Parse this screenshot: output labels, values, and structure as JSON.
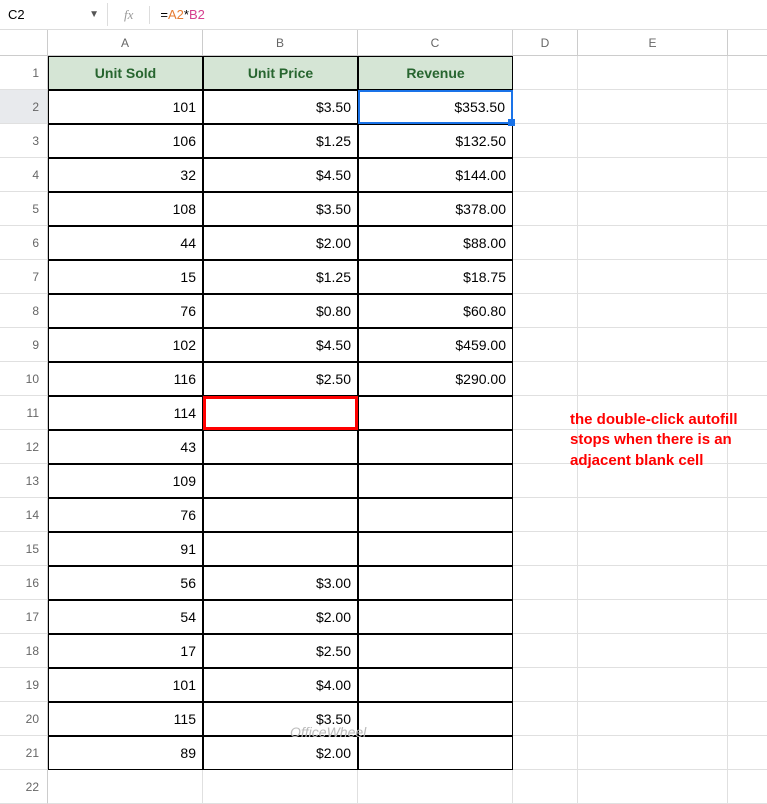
{
  "formula_bar": {
    "cell_ref": "C2",
    "fx_label": "fx",
    "formula_equals": "=",
    "formula_ref1": "A2",
    "formula_op": "*",
    "formula_ref2": "B2"
  },
  "columns": [
    "A",
    "B",
    "C",
    "D",
    "E"
  ],
  "headers": {
    "A": "Unit Sold",
    "B": "Unit Price",
    "C": "Revenue"
  },
  "rows": [
    {
      "n": "1",
      "A": "",
      "B": "",
      "C": ""
    },
    {
      "n": "2",
      "A": "101",
      "B": "$3.50",
      "C": "$353.50"
    },
    {
      "n": "3",
      "A": "106",
      "B": "$1.25",
      "C": "$132.50"
    },
    {
      "n": "4",
      "A": "32",
      "B": "$4.50",
      "C": "$144.00"
    },
    {
      "n": "5",
      "A": "108",
      "B": "$3.50",
      "C": "$378.00"
    },
    {
      "n": "6",
      "A": "44",
      "B": "$2.00",
      "C": "$88.00"
    },
    {
      "n": "7",
      "A": "15",
      "B": "$1.25",
      "C": "$18.75"
    },
    {
      "n": "8",
      "A": "76",
      "B": "$0.80",
      "C": "$60.80"
    },
    {
      "n": "9",
      "A": "102",
      "B": "$4.50",
      "C": "$459.00"
    },
    {
      "n": "10",
      "A": "116",
      "B": "$2.50",
      "C": "$290.00"
    },
    {
      "n": "11",
      "A": "114",
      "B": "",
      "C": ""
    },
    {
      "n": "12",
      "A": "43",
      "B": "",
      "C": ""
    },
    {
      "n": "13",
      "A": "109",
      "B": "",
      "C": ""
    },
    {
      "n": "14",
      "A": "76",
      "B": "",
      "C": ""
    },
    {
      "n": "15",
      "A": "91",
      "B": "",
      "C": ""
    },
    {
      "n": "16",
      "A": "56",
      "B": "$3.00",
      "C": ""
    },
    {
      "n": "17",
      "A": "54",
      "B": "$2.00",
      "C": ""
    },
    {
      "n": "18",
      "A": "17",
      "B": "$2.50",
      "C": ""
    },
    {
      "n": "19",
      "A": "101",
      "B": "$4.00",
      "C": ""
    },
    {
      "n": "20",
      "A": "115",
      "B": "$3.50",
      "C": ""
    },
    {
      "n": "21",
      "A": "89",
      "B": "$2.00",
      "C": ""
    },
    {
      "n": "22",
      "A": "",
      "B": "",
      "C": ""
    }
  ],
  "selected_cell": "C2",
  "red_outline_cell": "B11",
  "annotation_text": "the double-click autofill stops when there is an adjacent blank cell",
  "watermark": "OfficeWheel"
}
